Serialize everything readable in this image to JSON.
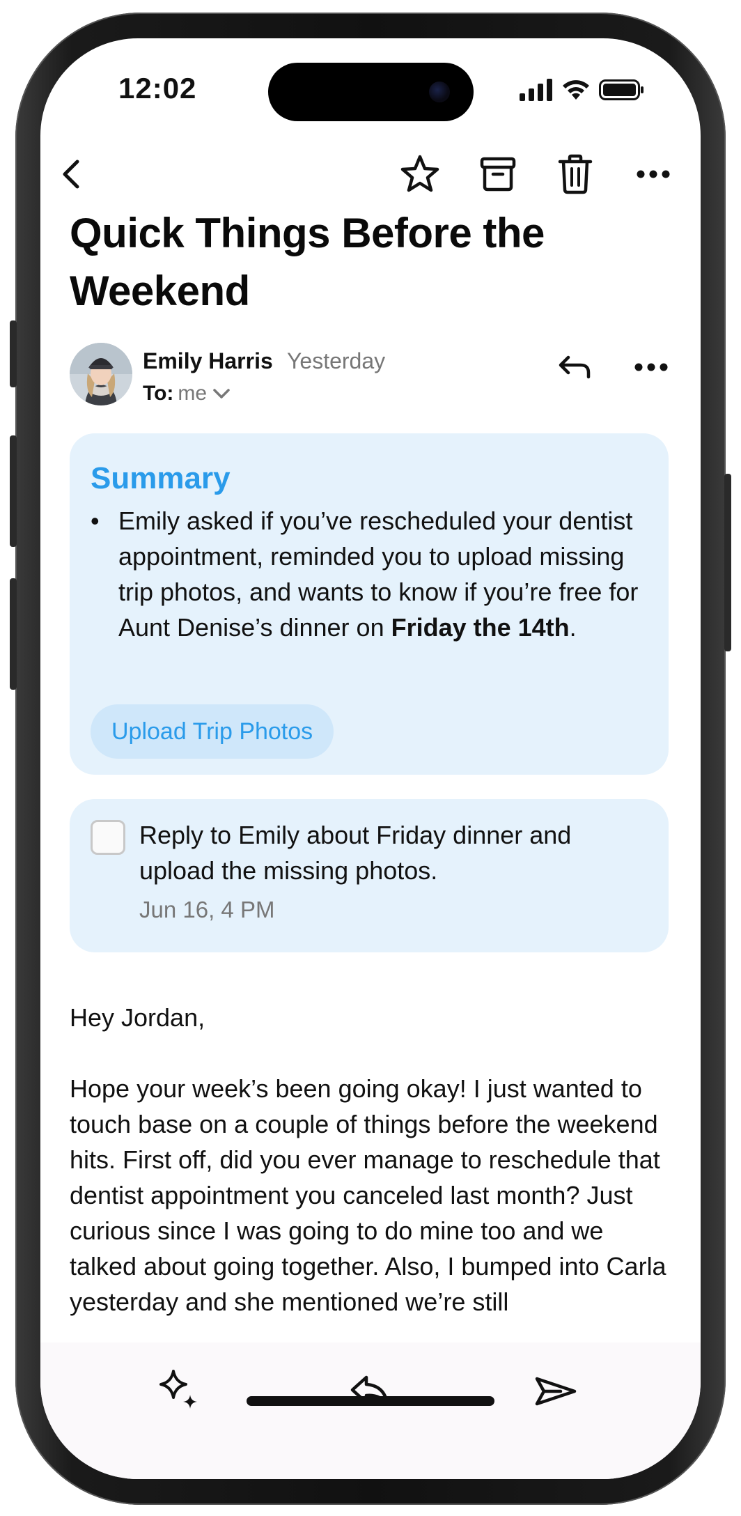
{
  "status_bar": {
    "time": "12:02"
  },
  "toolbar": {
    "back_icon": "chevron-left-icon",
    "star_icon": "star-icon",
    "archive_icon": "archive-icon",
    "trash_icon": "trash-icon",
    "more_icon": "ellipsis-icon"
  },
  "email": {
    "subject": "Quick Things Before the Weekend",
    "sender_name": "Emily Harris",
    "sent_date": "Yesterday",
    "to_label": "To:",
    "to_value": "me",
    "body_greeting": "Hey Jordan,",
    "body_paragraph": "Hope your week’s been going okay! I just wanted to touch base on a couple of things before the weekend hits. First off, did you ever manage to reschedule that dentist appointment you canceled last month? Just curious since I was going to do mine too and we talked about going together. Also, I bumped into Carla yesterday and she mentioned we’re still"
  },
  "summary": {
    "title": "Summary",
    "text_before": "Emily asked if you’ve rescheduled your dentist appointment, reminded you to upload missing trip photos, and wants to know if you’re free for Aunt Denise’s dinner on ",
    "text_bold": "Friday the 14th",
    "text_after": ".",
    "action_label": "Upload Trip Photos"
  },
  "task": {
    "text": "Reply to Emily about Friday dinner and upload the missing photos.",
    "due": "Jun 16, 4 PM"
  },
  "colors": {
    "accent": "#2a9bea",
    "card_bg": "#e5f2fc",
    "chip_bg": "#cfe7fa",
    "muted_text": "#777777"
  }
}
